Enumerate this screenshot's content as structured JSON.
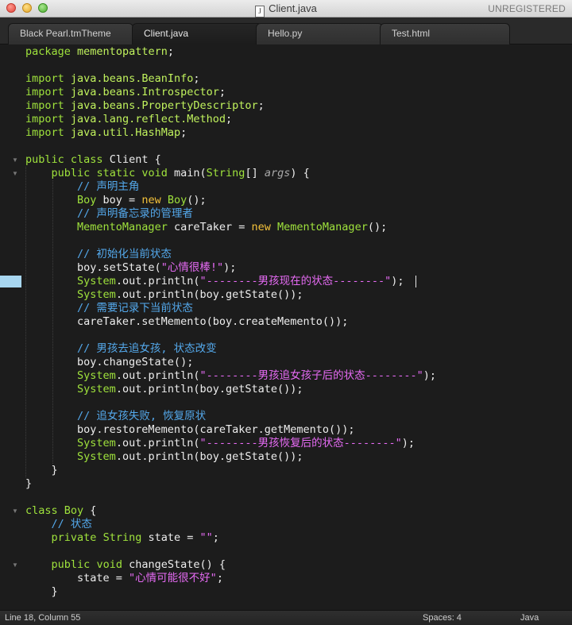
{
  "window": {
    "title": "Client.java",
    "file_icon_glyph": "J",
    "registration": "UNREGISTERED"
  },
  "tabs": [
    {
      "label": "Black Pearl.tmTheme",
      "active": false
    },
    {
      "label": "Client.java",
      "active": true
    },
    {
      "label": "Hello.py",
      "active": false
    },
    {
      "label": "Test.html",
      "active": false
    }
  ],
  "editor": {
    "language": "Java",
    "current_line": 18,
    "current_column": 55,
    "lines": [
      "package mementopattern;",
      "",
      "import java.beans.BeanInfo;",
      "import java.beans.Introspector;",
      "import java.beans.PropertyDescriptor;",
      "import java.lang.reflect.Method;",
      "import java.util.HashMap;",
      "",
      "public class Client {",
      "    public static void main(String[] args) {",
      "        // 声明主角",
      "        Boy boy = new Boy();",
      "        // 声明备忘录的管理者",
      "        MementoManager careTaker = new MementoManager();",
      "",
      "        // 初始化当前状态",
      "        boy.setState(\"心情很棒!\");",
      "        System.out.println(\"--------男孩现在的状态--------\");",
      "        System.out.println(boy.getState());",
      "        // 需要记录下当前状态",
      "        careTaker.setMemento(boy.createMemento());",
      "",
      "        // 男孩去追女孩, 状态改变",
      "        boy.changeState();",
      "        System.out.println(\"--------男孩追女孩子后的状态--------\");",
      "        System.out.println(boy.getState());",
      "",
      "        // 追女孩失败, 恢复原状",
      "        boy.restoreMemento(careTaker.getMemento());",
      "        System.out.println(\"--------男孩恢复后的状态--------\");",
      "        System.out.println(boy.getState());",
      "    }",
      "}",
      "",
      "class Boy {",
      "    // 状态",
      "    private String state = \"\";",
      "",
      "    public void changeState() {",
      "        state = \"心情可能很不好\";",
      "    }"
    ]
  },
  "statusbar": {
    "position_text": "Line 18, Column 55",
    "indentation": "Spaces: 4",
    "syntax": "Java"
  },
  "colors": {
    "background": "#1c1c1c",
    "keyword": "#9fe23c",
    "comment": "#54a9ec",
    "string": "#e76bf5",
    "new_keyword": "#f4c23a",
    "text": "#ededed",
    "line_marker": "#a8d6f0"
  }
}
